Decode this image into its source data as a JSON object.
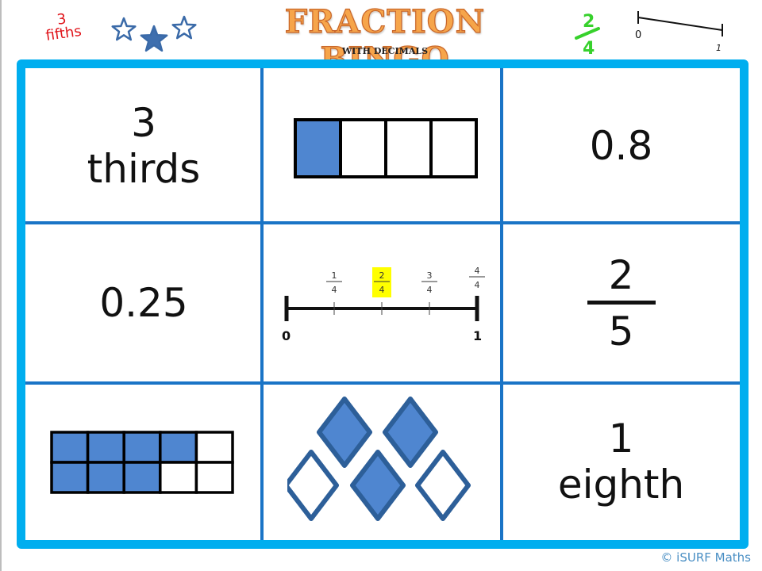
{
  "header": {
    "title": "FRACTION BINGO",
    "subtitle": "WITH DECIMALS",
    "decor_left_text": {
      "numerator": "3",
      "word": "fifths",
      "color": "#e0161c"
    },
    "decor_stars": {
      "count": 3,
      "filled_index": 1,
      "color": "#3a6aa8"
    },
    "decor_fraction": {
      "numerator": "2",
      "denominator": "4",
      "color": "#37d12c"
    },
    "decor_number_line": {
      "start_label": "0",
      "end_label": "1"
    }
  },
  "colors": {
    "board_border": "#00aeef",
    "grid_lines": "#1a74c6",
    "shade_fill": "#4f86d0",
    "shape_outline": "#2d5f99",
    "highlight": "#ffff00"
  },
  "board": {
    "cells": [
      {
        "type": "words",
        "lines": [
          "3",
          "thirds"
        ]
      },
      {
        "type": "bar_model",
        "parts": 4,
        "shaded": 1
      },
      {
        "type": "decimal",
        "text": "0.8"
      },
      {
        "type": "decimal",
        "text": "0.25"
      },
      {
        "type": "number_line",
        "start": "0",
        "end": "1",
        "ticks": [
          {
            "num": "1",
            "den": "4",
            "highlighted": false
          },
          {
            "num": "2",
            "den": "4",
            "highlighted": true
          },
          {
            "num": "3",
            "den": "4",
            "highlighted": false
          },
          {
            "num": "4",
            "den": "4",
            "highlighted": false
          }
        ]
      },
      {
        "type": "fraction",
        "numerator": "2",
        "denominator": "5"
      },
      {
        "type": "grid_model",
        "rows": 2,
        "cols": 5,
        "shaded_per_row": [
          4,
          3
        ]
      },
      {
        "type": "set_model",
        "total": 5,
        "shaded": 3
      },
      {
        "type": "words",
        "lines": [
          "1",
          "eighth"
        ]
      }
    ]
  },
  "footer": {
    "copyright": "© iSURF Maths"
  }
}
